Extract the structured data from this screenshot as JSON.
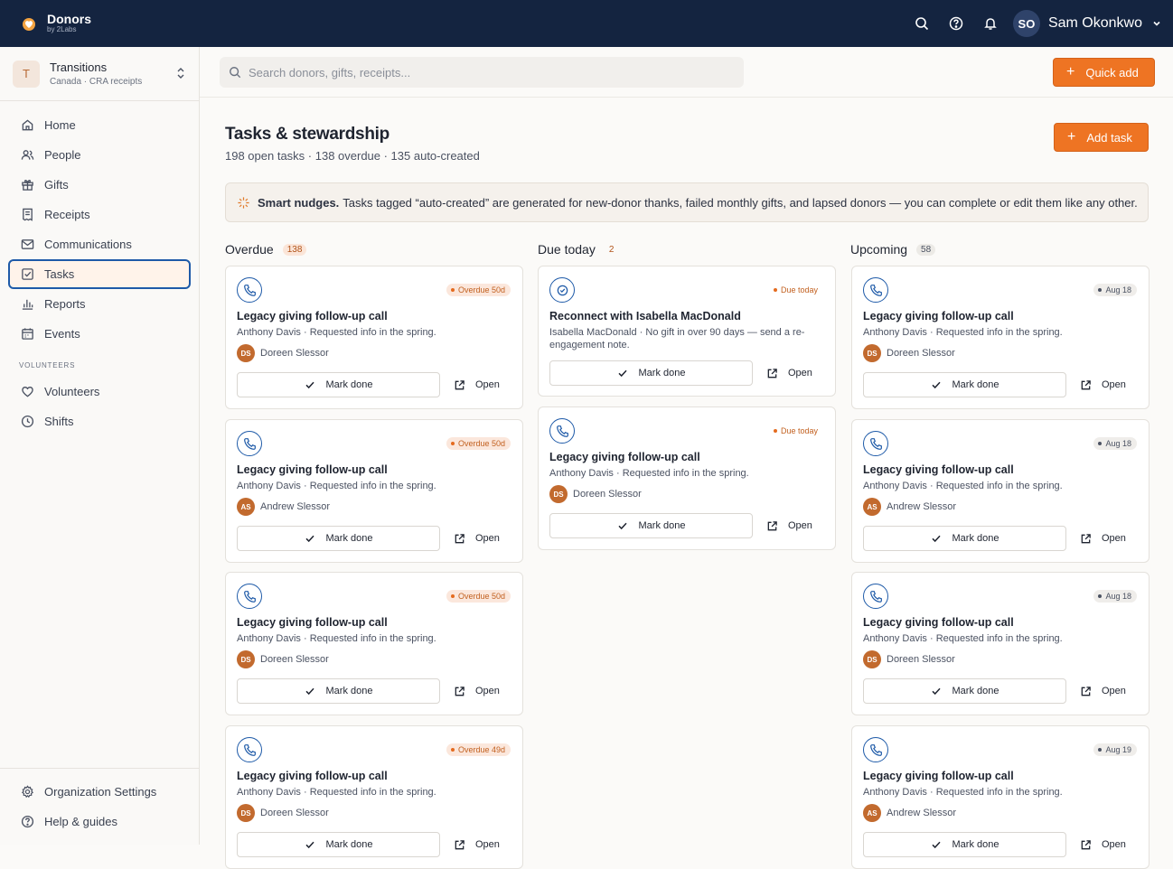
{
  "app": {
    "name": "Donors",
    "sub": "by 2Labs"
  },
  "user": {
    "initials": "SO",
    "name": "Sam Okonkwo"
  },
  "org": {
    "initial": "T",
    "name": "Transitions",
    "sub": "Canada · CRA receipts"
  },
  "nav": {
    "home": "Home",
    "people": "People",
    "gifts": "Gifts",
    "receipts": "Receipts",
    "communications": "Communications",
    "tasks": "Tasks",
    "reports": "Reports",
    "events": "Events",
    "section_volunteers": "VOLUNTEERS",
    "volunteers": "Volunteers",
    "shifts": "Shifts",
    "org_settings": "Organization Settings",
    "help": "Help & guides"
  },
  "search": {
    "placeholder": "Search donors, gifts, receipts..."
  },
  "quick_add": "Quick add",
  "page": {
    "title": "Tasks & stewardship",
    "subtitle": "198 open tasks · 138 overdue · 135 auto-created",
    "add_task": "Add task"
  },
  "nudge": {
    "bold": "Smart nudges.",
    "text": "Tasks tagged “auto-created” are generated for new-donor thanks, failed monthly gifts, and lapsed donors — you can complete or edit them like any other."
  },
  "labels": {
    "mark_done": "Mark done",
    "open": "Open"
  },
  "colors": {
    "brand_navy": "#142440",
    "accent_orange": "#ee7423",
    "icon_blue": "#1e5aa8"
  },
  "columns": {
    "overdue": {
      "title": "Overdue",
      "count": "138",
      "cards": [
        {
          "title": "Legacy giving follow-up call",
          "desc": "Anthony Davis · Requested info in the spring.",
          "owner_initials": "DS",
          "owner": "Doreen Slessor",
          "badge": "Overdue 50d"
        },
        {
          "title": "Legacy giving follow-up call",
          "desc": "Anthony Davis · Requested info in the spring.",
          "owner_initials": "AS",
          "owner": "Andrew Slessor",
          "badge": "Overdue 50d"
        },
        {
          "title": "Legacy giving follow-up call",
          "desc": "Anthony Davis · Requested info in the spring.",
          "owner_initials": "DS",
          "owner": "Doreen Slessor",
          "badge": "Overdue 50d"
        },
        {
          "title": "Legacy giving follow-up call",
          "desc": "Anthony Davis · Requested info in the spring.",
          "owner_initials": "DS",
          "owner": "Doreen Slessor",
          "badge": "Overdue 49d"
        }
      ]
    },
    "due_today": {
      "title": "Due today",
      "count": "2",
      "cards": [
        {
          "title": "Reconnect with Isabella MacDonald",
          "desc": "Isabella MacDonald · No gift in over 90 days — send a re-engagement note.",
          "badge": "Due today"
        },
        {
          "title": "Legacy giving follow-up call",
          "desc": "Anthony Davis · Requested info in the spring.",
          "owner_initials": "DS",
          "owner": "Doreen Slessor",
          "badge": "Due today"
        }
      ]
    },
    "upcoming": {
      "title": "Upcoming",
      "count": "58",
      "cards": [
        {
          "title": "Legacy giving follow-up call",
          "desc": "Anthony Davis · Requested info in the spring.",
          "owner_initials": "DS",
          "owner": "Doreen Slessor",
          "badge": "Aug 18"
        },
        {
          "title": "Legacy giving follow-up call",
          "desc": "Anthony Davis · Requested info in the spring.",
          "owner_initials": "AS",
          "owner": "Andrew Slessor",
          "badge": "Aug 18"
        },
        {
          "title": "Legacy giving follow-up call",
          "desc": "Anthony Davis · Requested info in the spring.",
          "owner_initials": "DS",
          "owner": "Doreen Slessor",
          "badge": "Aug 18"
        },
        {
          "title": "Legacy giving follow-up call",
          "desc": "Anthony Davis · Requested info in the spring.",
          "owner_initials": "AS",
          "owner": "Andrew Slessor",
          "badge": "Aug 19"
        }
      ]
    }
  }
}
